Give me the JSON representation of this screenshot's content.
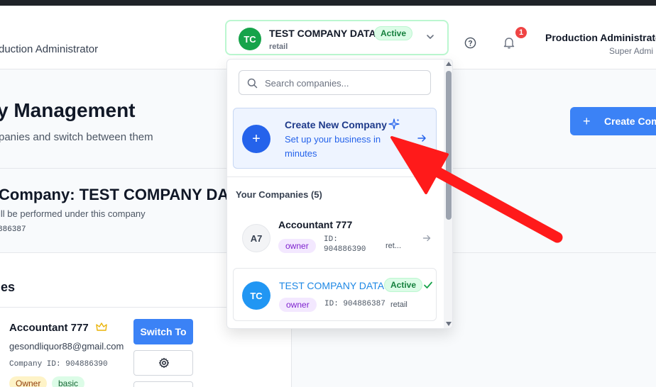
{
  "header": {
    "left_title": "duction Administrator",
    "company_switcher": {
      "avatar": "TC",
      "name": "TEST COMPANY DATA",
      "status": "Active",
      "category": "retail"
    },
    "notification_count": "1",
    "user_name": "Production Administrator",
    "user_role": "Super Admi"
  },
  "main": {
    "title": "y Management",
    "subtitle": "panies and switch between them",
    "create_button_label": "Create Com",
    "current_company_title": "Company: TEST COMPANY DAT",
    "current_company_note": "ill be performed under this company",
    "current_company_id": "886387"
  },
  "companies_panel": {
    "heading": "ies",
    "card": {
      "name": "Accountant 777",
      "email": "gesondliquor88@gmail.com",
      "company_id": "Company ID: 904886390",
      "tag_role": "Owner",
      "tag_plan": "basic",
      "switch_label": "Switch To"
    }
  },
  "dropdown": {
    "search_placeholder": "Search companies...",
    "create": {
      "title": "Create New Company",
      "description": "Set up your business in minutes"
    },
    "your_companies_label": "Your Companies (5)",
    "items": [
      {
        "avatar": "A7",
        "name": "Accountant 777",
        "role": "owner",
        "id": "ID: 904886390",
        "category": "ret..."
      },
      {
        "avatar": "TC",
        "name": "TEST COMPANY DATA",
        "status": "Active",
        "role": "owner",
        "id": "ID: 904886387",
        "category": "retail"
      }
    ]
  },
  "colors": {
    "primary": "#3b82f6",
    "active_green": "#16a34a",
    "annotation_arrow": "#ff1a1a",
    "badge_red": "#ef4444"
  },
  "icons": [
    "chevron-down-icon",
    "help-icon",
    "bell-icon",
    "search-icon",
    "plus-icon",
    "sparkle-icon",
    "arrow-right-icon",
    "check-icon",
    "crown-icon",
    "gear-icon"
  ]
}
